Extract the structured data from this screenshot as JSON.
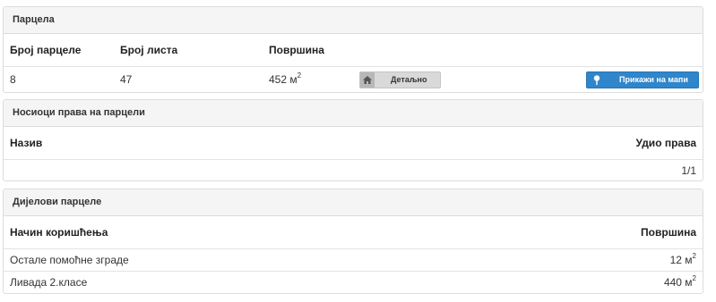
{
  "parcel": {
    "heading": "Парцела",
    "columns": {
      "number": "Број парцеле",
      "sheet": "Број листа",
      "area": "Површина"
    },
    "row": {
      "number": "8",
      "sheet": "47",
      "area": "452 м",
      "area_sup": "2"
    },
    "detail_button": {
      "label": "Детаљно",
      "icon": "home-icon"
    },
    "map_button": {
      "label": "Прикажи на мапи",
      "icon": "map-pin-icon"
    }
  },
  "holders": {
    "heading": "Носиоци права на парцели",
    "columns": {
      "name": "Назив",
      "share": "Удио права"
    },
    "rows": [
      {
        "name": "",
        "share": "1/1"
      }
    ]
  },
  "parts": {
    "heading": "Дијелови парцеле",
    "columns": {
      "usage": "Начин коришћења",
      "area": "Површина"
    },
    "rows": [
      {
        "usage": "Остале помоћне зграде",
        "area": "12 м",
        "area_sup": "2"
      },
      {
        "usage": "Ливада 2.класе",
        "area": "440 м",
        "area_sup": "2"
      }
    ]
  },
  "colors": {
    "accent": "#2f86cb",
    "panel_heading_bg": "#f5f5f5",
    "border": "#dcdcdc"
  }
}
